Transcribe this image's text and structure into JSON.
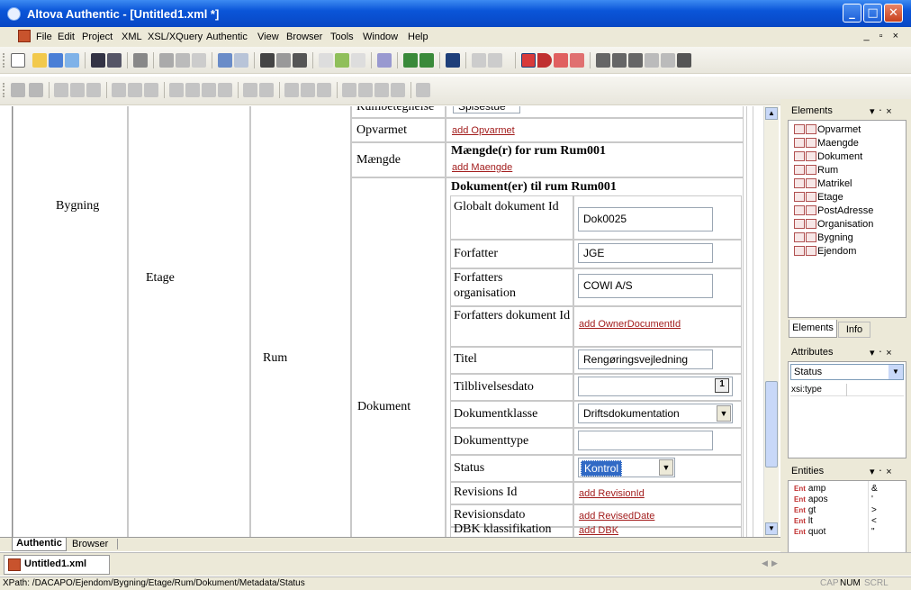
{
  "title": "Altova Authentic - [Untitled1.xml *]",
  "window_buttons": {
    "minimize": "_",
    "maximize": "□",
    "close": "✕"
  },
  "menu": [
    "File",
    "Edit",
    "Project",
    "XML",
    "XSL/XQuery",
    "Authentic",
    "View",
    "Browser",
    "Tools",
    "Window",
    "Help"
  ],
  "mdi_controls": "_ ▫ ×",
  "doc": {
    "bygning": "Bygning",
    "etage": "Etage",
    "rum": "Rum",
    "dokument": "Dokument",
    "rumbetegnelse_label": "Rumbetegnelse",
    "rumbetegnelse_value": "Spisestue",
    "opvarmet_label": "Opvarmet",
    "opvarmet_add": "add Opvarmet",
    "maengde_label": "Mængde",
    "maengde_heading": "Mængde(r) for rum Rum001",
    "maengde_add": "add Maengde",
    "dok_heading": "Dokument(er) til rum Rum001",
    "fields": [
      {
        "label": "Globalt dokument Id",
        "value": "Dok0025"
      },
      {
        "label": "Forfatter",
        "value": "JGE"
      },
      {
        "label": "Forfatters organisation",
        "value": "COWI A/S"
      },
      {
        "label": "Forfatters dokument Id",
        "add": "add OwnerDocumentId"
      },
      {
        "label": "Titel",
        "value": "Rengøringsvejledning"
      },
      {
        "label": "Tilblivelsesdato",
        "value": ""
      },
      {
        "label": "Dokumentklasse",
        "value": "Driftsdokumentation"
      },
      {
        "label": "Dokumenttype",
        "value": ""
      },
      {
        "label": "Status",
        "value": "Kontrol"
      },
      {
        "label": "Revisions Id",
        "add": "add RevisionId"
      },
      {
        "label": "Revisionsdato",
        "add": "add RevisedDate"
      },
      {
        "label": "DBK klassifikation",
        "add": "add DBK"
      }
    ]
  },
  "bottom_tabs": {
    "authentic": "Authentic",
    "browser": "Browser"
  },
  "file_tab": "Untitled1.xml",
  "elements_panel": {
    "title": "Elements",
    "items": [
      "Opvarmet",
      "Maengde",
      "Dokument",
      "Rum",
      "Matrikel",
      "Etage",
      "PostAdresse",
      "Organisation",
      "Bygning",
      "Ejendom"
    ],
    "tab1": "Elements",
    "tab2": "Info"
  },
  "attributes_panel": {
    "title": "Attributes",
    "select_value": "Status",
    "row_name": "xsi:type"
  },
  "entities_panel": {
    "title": "Entities",
    "tag": "Ent",
    "items": [
      {
        "name": "amp",
        "val": "&"
      },
      {
        "name": "apos",
        "val": "'"
      },
      {
        "name": "gt",
        "val": ">"
      },
      {
        "name": "lt",
        "val": "<"
      },
      {
        "name": "quot",
        "val": "\""
      }
    ]
  },
  "panel_controls": "▾ ᛫ ×",
  "statusbar": {
    "path": "XPath: /DACAPO/Ejendom/Bygning/Etage/Rum/Dokument/Metadata/Status",
    "cap": "CAP",
    "num": "NUM",
    "scrl": "SCRL"
  },
  "colors": {
    "titlebar": "#0a55d8",
    "link": "#a21c1c",
    "select_highlight": "#316ac5"
  }
}
